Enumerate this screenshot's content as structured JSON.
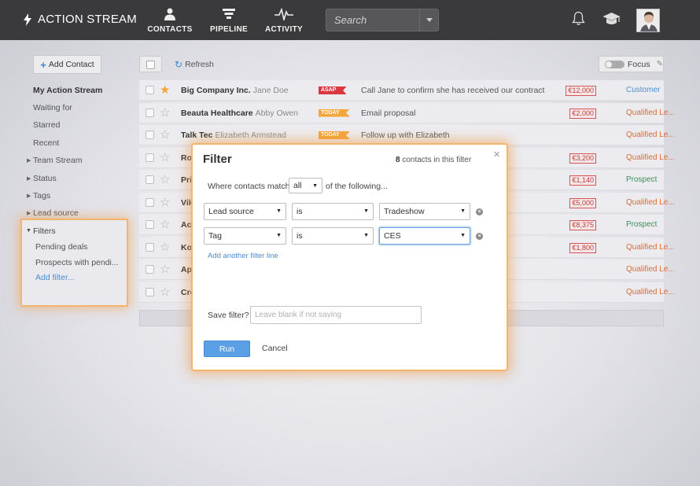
{
  "app": {
    "title": "ACTION STREAM"
  },
  "nav": [
    {
      "label": "CONTACTS",
      "icon": "person-icon"
    },
    {
      "label": "PIPELINE",
      "icon": "pipeline-icon"
    },
    {
      "label": "ACTIVITY",
      "icon": "activity-icon"
    }
  ],
  "search": {
    "placeholder": "Search"
  },
  "sidebar": {
    "add_contact": "Add Contact",
    "items": [
      {
        "label": "My Action Stream"
      },
      {
        "label": "Waiting for"
      },
      {
        "label": "Starred"
      },
      {
        "label": "Recent"
      },
      {
        "label": "Team Stream"
      },
      {
        "label": "Status"
      },
      {
        "label": "Tags"
      },
      {
        "label": "Lead source"
      }
    ],
    "filters": {
      "label": "Filters",
      "items": [
        "Pending deals",
        "Prospects with pendi...",
        "Add filter..."
      ]
    }
  },
  "toolbar": {
    "refresh": "Refresh",
    "focus": "Focus"
  },
  "rows": [
    {
      "company": "Big Company Inc.",
      "person": "Jane Doe",
      "tag": "ASAP",
      "tag_color": "red",
      "action": "Call Jane to confirm she has received our contract",
      "amount": "€12,000",
      "status": "Customer",
      "status_type": "customer",
      "starred": true
    },
    {
      "company": "Beauta Healthcare",
      "person": "Abby Owen",
      "tag": "TODAY",
      "tag_color": "orange",
      "action": "Email proposal",
      "amount": "€2,000",
      "status": "Qualified Le...",
      "status_type": "qual",
      "starred": false
    },
    {
      "company": "Talk Tec",
      "person": "Elizabeth Armstead",
      "tag": "TODAY",
      "tag_color": "orange",
      "action": "Follow up with Elizabeth",
      "amount": "",
      "status": "Qualified Le...",
      "status_type": "qual",
      "starred": false
    },
    {
      "company": "Ro",
      "person": "",
      "tag": "",
      "tag_color": "",
      "action": "",
      "amount": "€3,200",
      "status": "Qualified Le...",
      "status_type": "qual",
      "starred": false
    },
    {
      "company": "Pri",
      "person": "",
      "tag": "",
      "tag_color": "",
      "action": "",
      "amount": "€1,140",
      "status": "Prospect",
      "status_type": "prospect",
      "starred": false
    },
    {
      "company": "Vik",
      "person": "",
      "tag": "",
      "tag_color": "",
      "action": "",
      "amount": "€5,000",
      "status": "Qualified Le...",
      "status_type": "qual",
      "starred": false
    },
    {
      "company": "Acr",
      "person": "",
      "tag": "",
      "tag_color": "",
      "action": "",
      "amount": "€8,375",
      "status": "Prospect",
      "status_type": "prospect",
      "starred": false
    },
    {
      "company": "Kos",
      "person": "",
      "tag": "",
      "tag_color": "",
      "action": "",
      "amount": "€1,800",
      "status": "Qualified Le...",
      "status_type": "qual",
      "starred": false
    },
    {
      "company": "Ape",
      "person": "",
      "tag": "",
      "tag_color": "",
      "action": "",
      "amount": "",
      "status": "Qualified Le...",
      "status_type": "qual",
      "starred": false
    },
    {
      "company": "Cre",
      "person": "",
      "tag": "",
      "tag_color": "",
      "action": "",
      "amount": "",
      "status": "Qualified Le...",
      "status_type": "qual",
      "starred": false
    }
  ],
  "modal": {
    "title": "Filter",
    "count_num": "8",
    "count_text": "contacts in this filter",
    "match_label": "Where contacts match",
    "match_value": "all",
    "match_tail": "of the following...",
    "lines": [
      {
        "field": "Lead source",
        "op": "is",
        "value": "Tradeshow"
      },
      {
        "field": "Tag",
        "op": "is",
        "value": "CES"
      }
    ],
    "add_line": "Add another filter line",
    "save_label": "Save filter?",
    "save_placeholder": "Leave blank if not saving",
    "run": "Run",
    "cancel": "Cancel"
  },
  "colors": {
    "accent": "#5b9fe6",
    "topbar": "#3a3a3c",
    "highlight": "#f3b46e"
  }
}
